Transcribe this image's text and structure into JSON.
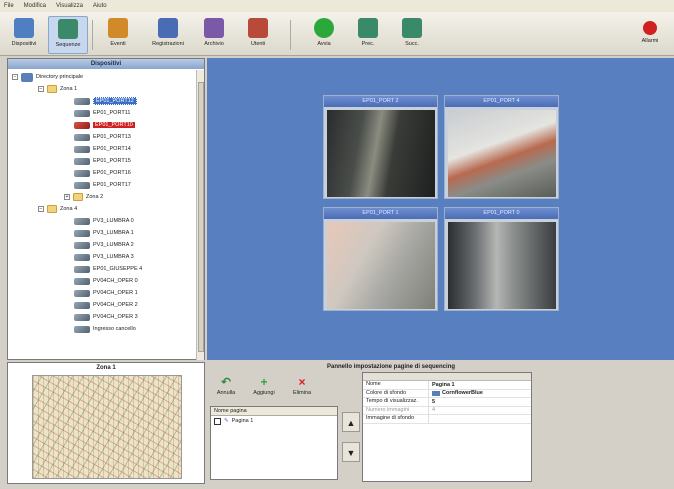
{
  "menu": {
    "items": [
      "File",
      "Modifica",
      "Visualizza",
      "Aiuto"
    ]
  },
  "toolbar": {
    "buttons": [
      {
        "label": "Dispositivi",
        "icon": "devices-icon",
        "color": "#4f7fc2"
      },
      {
        "label": "Sequenze",
        "icon": "sequence-icon",
        "color": "#3a8a6a"
      },
      {
        "label": "Eventi",
        "icon": "events-icon",
        "color": "#d08a2a"
      },
      {
        "label": "Registrazioni",
        "icon": "recordings-icon",
        "color": "#4a6cb4"
      },
      {
        "label": "Archivio",
        "icon": "archive-icon",
        "color": "#7a5aa8"
      },
      {
        "label": "Utenti",
        "icon": "users-icon",
        "color": "#b84a3a"
      },
      {
        "label": "Avvia",
        "icon": "play-icon",
        "color": "#2aa83a"
      },
      {
        "label": "Prec.",
        "icon": "previous-icon",
        "color": "#3a8a6a"
      },
      {
        "label": "Succ.",
        "icon": "next-icon",
        "color": "#3a8a6a"
      },
      {
        "label": "Allarmi",
        "icon": "alarm-icon",
        "color": "#d02020"
      }
    ]
  },
  "devices": {
    "title": "Dispositivi",
    "root": "Directory principale",
    "zone1": "Zona 1",
    "zone1_items": [
      "EP01_PORT12",
      "EP01_PORT11",
      "EP01_PORT10",
      "EP01_PORT13",
      "EP01_PORT14",
      "EP01_PORT15",
      "EP01_PORT16",
      "EP01_PORT17"
    ],
    "zone2": "Zona 2",
    "zone4": "Zona 4",
    "zone4_items": [
      "PV3_LUMBRA 0",
      "PV3_LUMBRA 1",
      "PV3_LUMBRA 2",
      "PV3_LUMBRA 3",
      "EP01_GIUSEPPE 4",
      "PV04CH_OPER 0",
      "PV04CH_OPER 1",
      "PV04CH_OPER 2",
      "PV04CH_OPER 3",
      "Ingresso cancello"
    ]
  },
  "map": {
    "title": "Zona 1"
  },
  "video": {
    "tiles": [
      {
        "title": "EP01_PORT 2"
      },
      {
        "title": "EP01_PORT 4"
      },
      {
        "title": "EP01_PORT 1"
      },
      {
        "title": "EP01_PORT 0"
      }
    ]
  },
  "sequence": {
    "title": "Pannello impostazione pagine di sequencing",
    "buttons": [
      "Annulla",
      "Aggiungi",
      "Elimina"
    ],
    "list_header": "Nome pagina",
    "pages": [
      "Pagina 1"
    ],
    "properties": [
      {
        "key": "Nome",
        "value": "Pagina 1"
      },
      {
        "key": "Colore di sfondo",
        "value": "CornflowerBlue",
        "swatch": "#5a7fb8"
      },
      {
        "key": "Tempo di visualizzaz.",
        "value": "5"
      },
      {
        "key": "Numero immagini",
        "value": "4"
      },
      {
        "key": "Immagine di sfondo",
        "value": ""
      }
    ]
  }
}
